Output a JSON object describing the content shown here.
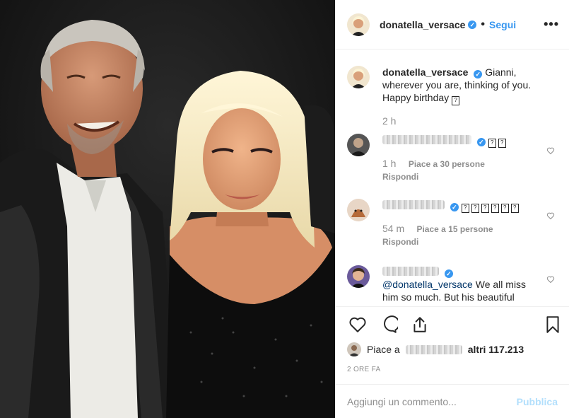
{
  "post": {
    "author": "donatella_versace",
    "follow_label": "Segui",
    "dot": "•",
    "more": "•••"
  },
  "caption": {
    "author": "donatella_versace",
    "text_line1": "Gianni,",
    "text_line2": "wherever you are, thinking of you.",
    "text_line3": "Happy birthday",
    "time": "2 h"
  },
  "comments": [
    {
      "emoji_count": 2,
      "time": "1 h",
      "likes": "Piace a 30 persone",
      "reply": "Rispondi"
    },
    {
      "emoji_count": 6,
      "time": "54 m",
      "likes": "Piace a 15 persone",
      "reply": "Rispondi"
    },
    {
      "mention": "@donatella_versace",
      "text_a": " We all miss",
      "text_b": "him so much. But his beautiful"
    }
  ],
  "likes_line": {
    "prefix": "Piace a",
    "suffix": "altri 117.213"
  },
  "date": "2 ORE FA",
  "add_comment": {
    "placeholder": "Aggiungi un commento...",
    "publish": "Pubblica"
  },
  "colors": {
    "accent": "#3897f0",
    "muted": "#8e8e8e",
    "publish_disabled": "#b2dffc"
  },
  "icons": [
    "heart-icon",
    "comment-icon",
    "share-icon",
    "bookmark-icon",
    "verified-badge-icon",
    "more-options-icon"
  ]
}
